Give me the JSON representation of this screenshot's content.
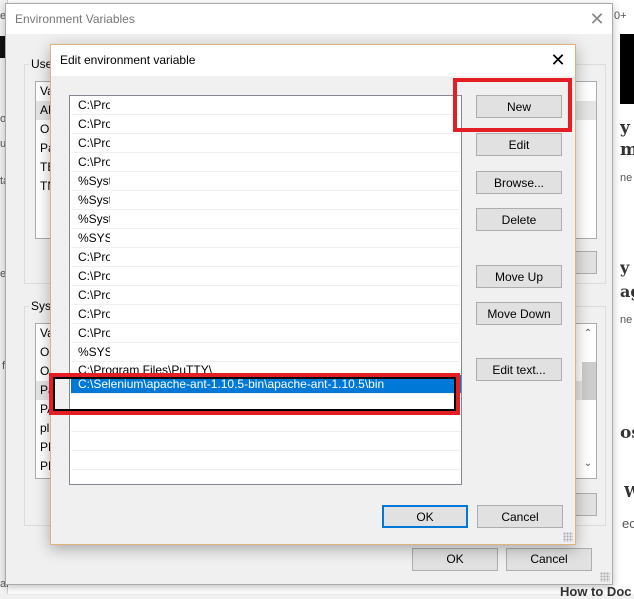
{
  "background": {
    "fragments": {
      "top_left": "es",
      "top_right": "0+",
      "right_heading_1": "y T",
      "right_heading_2": "m",
      "right_small_1": "ne",
      "right_heading_3": "y t",
      "right_heading_4": "ag",
      "right_small_2": "ne",
      "right_heading_5": "os",
      "right_heading_6": "W",
      "right_small_3": "ec",
      "bottom_right": "How to Doc",
      "left_1": "un",
      "left_2": "ta",
      "left_3": "o",
      "left_4": "ec",
      "left_5": "f",
      "left_6": "ar"
    }
  },
  "env_dialog": {
    "title": "Environment Variables",
    "close_icon": "close-icon",
    "user_group_label": "User",
    "user_list": {
      "header": "Va",
      "rows": [
        "AN",
        "On",
        "Pa",
        "TE",
        "TN"
      ]
    },
    "system_group_label": "Syste",
    "system_list": {
      "header": "Va",
      "rows": [
        "Or",
        "OI",
        "Pa",
        "PA",
        "pl",
        "PF",
        "PF"
      ]
    },
    "ok_label": "OK",
    "cancel_label": "Cancel"
  },
  "edit_dialog": {
    "title": "Edit environment variable",
    "close_icon": "close-icon",
    "paths": [
      "C:\\Pro",
      "C:\\Pro",
      "C:\\Pro",
      "C:\\Pro",
      "%Syst",
      "%Syst",
      "%Syst",
      "%SYST",
      "C:\\Pro",
      "C:\\Pro",
      "C:\\Pro",
      "C:\\Pro",
      "C:\\Pro",
      "%SYST",
      "C:\\Program Files\\PuTTY\\"
    ],
    "selected_path": "C:\\Selenium\\apache-ant-1.10.5-bin\\apache-ant-1.10.5\\bin",
    "buttons": {
      "new": "New",
      "edit": "Edit",
      "browse": "Browse...",
      "delete": "Delete",
      "move_up": "Move Up",
      "move_down": "Move Down",
      "edit_text": "Edit text..."
    },
    "ok_label": "OK",
    "cancel_label": "Cancel"
  },
  "annotations": {
    "highlight_color": "#e31e24",
    "selection_color": "#0078d7"
  }
}
